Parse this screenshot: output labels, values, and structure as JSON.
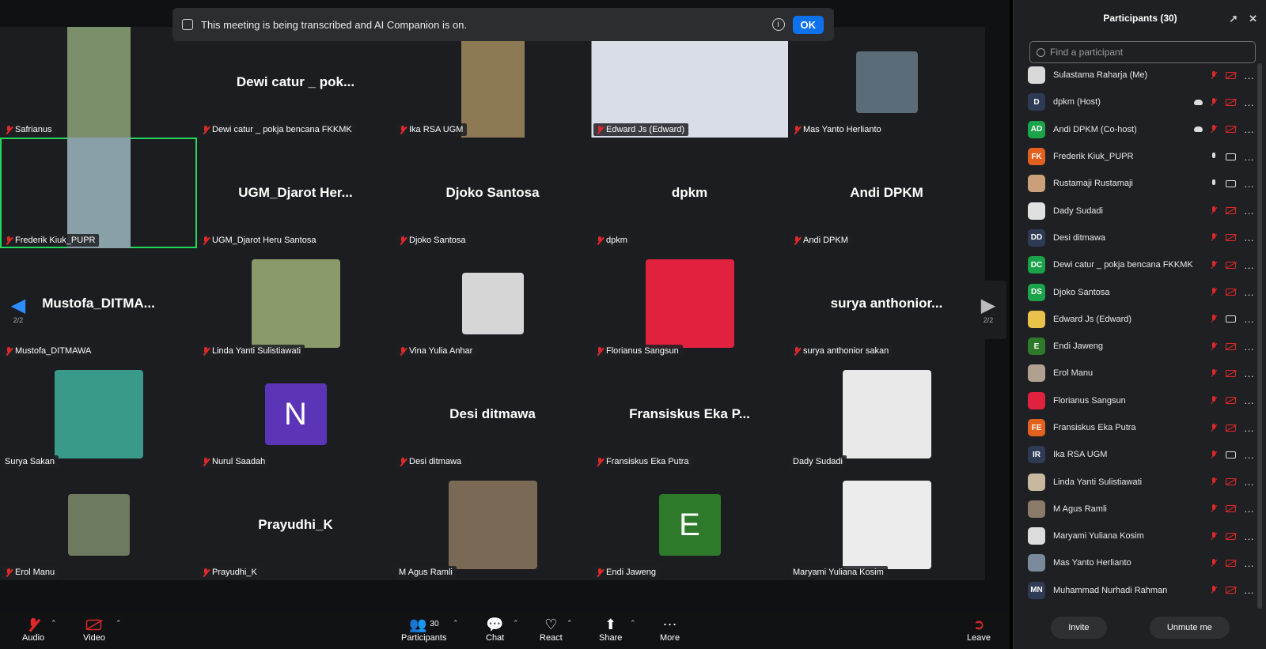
{
  "banner": {
    "text": "This meeting is being transcribed and AI Companion is on.",
    "ok_label": "OK",
    "info_glyph": "i"
  },
  "nav": {
    "left_page": "2/2",
    "right_page": "2/2"
  },
  "tiles": [
    {
      "name": "Safrianus",
      "kind": "video",
      "bg": "#7a8f6a"
    },
    {
      "name": "Dewi catur _ pokja bencana FKKMK",
      "display": "Dewi catur _ pok...",
      "kind": "name"
    },
    {
      "name": "Ika RSA UGM",
      "kind": "video",
      "bg": "#8d7a55"
    },
    {
      "name": "Edward Js (Edward)",
      "kind": "video",
      "bg": "#d8dde6"
    },
    {
      "name": "Mas Yanto Herlianto",
      "kind": "avatar",
      "bg": "#5c6b78"
    },
    {
      "name": "Frederik Kiuk_PUPR",
      "kind": "video",
      "bg": "#8aa0a8"
    },
    {
      "name": "UGM_Djarot Heru Santosa",
      "display": "UGM_Djarot  Her...",
      "kind": "name"
    },
    {
      "name": "Djoko Santosa",
      "display": "Djoko Santosa",
      "kind": "name"
    },
    {
      "name": "dpkm",
      "display": "dpkm",
      "kind": "name"
    },
    {
      "name": "Andi DPKM",
      "display": "Andi DPKM",
      "kind": "name"
    },
    {
      "name": "Mustofa_DITMAWA",
      "display": "Mustofa_DITMA...",
      "kind": "name"
    },
    {
      "name": "Linda Yanti Sulistiawati",
      "kind": "avatar-big",
      "bg": "#8a9a6a"
    },
    {
      "name": "Vina Yulia Anhar",
      "kind": "avatar",
      "bg": "#d6d6d6"
    },
    {
      "name": "Florianus Sangsun",
      "kind": "avatar-big",
      "bg": "#e0223f"
    },
    {
      "name": "surya anthonior sakan",
      "display": "surya  anthonior...",
      "kind": "name"
    },
    {
      "name": "Surya Sakan",
      "kind": "avatar-big",
      "bg": "#3a9a8a"
    },
    {
      "name": "Nurul Saadah",
      "kind": "letter",
      "letter": "N",
      "bg": "#5b35b5"
    },
    {
      "name": "Desi ditmawa",
      "display": "Desi ditmawa",
      "kind": "name"
    },
    {
      "name": "Fransiskus Eka Putra",
      "display": "Fransiskus  Eka  P...",
      "kind": "name"
    },
    {
      "name": "Dady Sudadi",
      "kind": "avatar-big",
      "bg": "#e9e9e9"
    },
    {
      "name": "Erol Manu",
      "kind": "avatar",
      "bg": "#6d7a60"
    },
    {
      "name": "Prayudhi_K",
      "display": "Prayudhi_K",
      "kind": "name"
    },
    {
      "name": "M Agus Ramli",
      "kind": "avatar-big",
      "bg": "#7a6a55"
    },
    {
      "name": "Endi Jaweng",
      "kind": "letter",
      "letter": "E",
      "bg": "#2e7a2a"
    },
    {
      "name": "Maryami Yuliana Kosim",
      "kind": "avatar-big",
      "bg": "#ececec"
    }
  ],
  "toolbar": {
    "audio": "Audio",
    "video": "Video",
    "participants": "Participants",
    "participants_count": "30",
    "chat": "Chat",
    "react": "React",
    "share": "Share",
    "more": "More",
    "leave": "Leave"
  },
  "panel": {
    "title": "Participants (30)",
    "search_placeholder": "Find a participant",
    "invite": "Invite",
    "unmute_me": "Unmute me",
    "participants": [
      {
        "name": "Sulastama Raharja (Me)",
        "initials": "",
        "bg": "#d9d9d9",
        "mic": "off",
        "cam": "off"
      },
      {
        "name": "dpkm (Host)",
        "initials": "D",
        "bg": "#2f3b55",
        "mic": "off",
        "cam": "off",
        "cloud": true
      },
      {
        "name": "Andi DPKM (Co-host)",
        "initials": "AD",
        "bg": "#1aa34a",
        "mic": "off",
        "cam": "off",
        "cloud": true
      },
      {
        "name": "Frederik Kiuk_PUPR",
        "initials": "FK",
        "bg": "#e2611e",
        "mic": "on",
        "cam": "on"
      },
      {
        "name": "Rustamaji Rustamaji",
        "initials": "",
        "bg": "#c9a07a",
        "mic": "on",
        "cam": "on"
      },
      {
        "name": "Dady Sudadi",
        "initials": "",
        "bg": "#e0e0e0",
        "mic": "off",
        "cam": "off"
      },
      {
        "name": "Desi ditmawa",
        "initials": "DD",
        "bg": "#2f3b55",
        "mic": "off",
        "cam": "off"
      },
      {
        "name": "Dewi catur _ pokja bencana FKKMK",
        "initials": "DC",
        "bg": "#1aa34a",
        "mic": "off",
        "cam": "off"
      },
      {
        "name": "Djoko Santosa",
        "initials": "DS",
        "bg": "#1aa34a",
        "mic": "off",
        "cam": "off"
      },
      {
        "name": "Edward Js (Edward)",
        "initials": "",
        "bg": "#e8c24a",
        "mic": "off",
        "cam": "on"
      },
      {
        "name": "Endi Jaweng",
        "initials": "E",
        "bg": "#2e7a2a",
        "mic": "off",
        "cam": "off"
      },
      {
        "name": "Erol Manu",
        "initials": "",
        "bg": "#b0a090",
        "mic": "off",
        "cam": "off"
      },
      {
        "name": "Florianus Sangsun",
        "initials": "",
        "bg": "#e0223f",
        "mic": "off",
        "cam": "off"
      },
      {
        "name": "Fransiskus Eka Putra",
        "initials": "FE",
        "bg": "#e2611e",
        "mic": "off",
        "cam": "off"
      },
      {
        "name": "Ika RSA UGM",
        "initials": "IR",
        "bg": "#2f3b55",
        "mic": "off",
        "cam": "on"
      },
      {
        "name": "Linda Yanti Sulistiawati",
        "initials": "",
        "bg": "#c8b8a0",
        "mic": "off",
        "cam": "off"
      },
      {
        "name": "M Agus Ramli",
        "initials": "",
        "bg": "#8a7a6a",
        "mic": "off",
        "cam": "off"
      },
      {
        "name": "Maryami Yuliana Kosim",
        "initials": "",
        "bg": "#dcdcdc",
        "mic": "off",
        "cam": "off"
      },
      {
        "name": "Mas Yanto Herlianto",
        "initials": "",
        "bg": "#7a8a9a",
        "mic": "off",
        "cam": "off"
      },
      {
        "name": "Muhammad Nurhadi Rahman",
        "initials": "MN",
        "bg": "#2f3b55",
        "mic": "off",
        "cam": "off"
      }
    ]
  }
}
